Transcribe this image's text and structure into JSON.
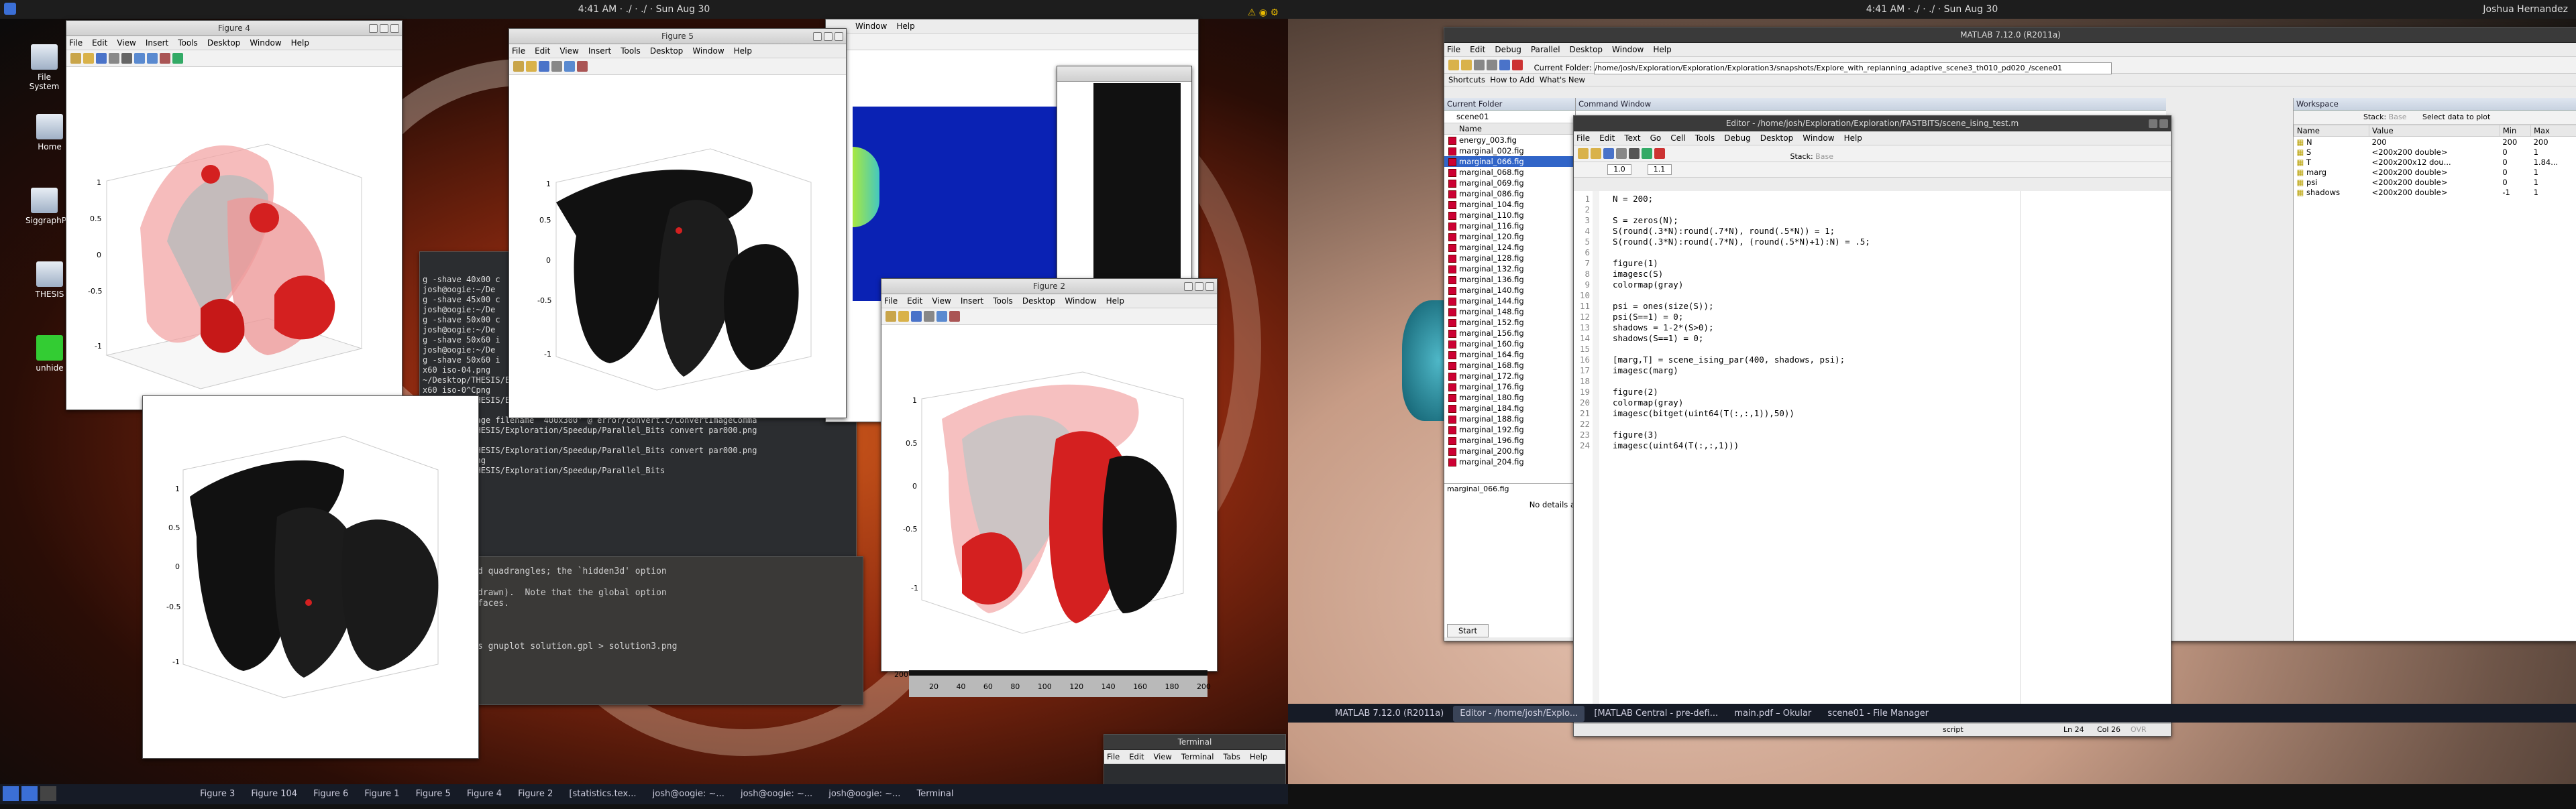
{
  "left_screen": {
    "topbar": {
      "clock": "4:41 AM · ./ · ./ · Sun Aug 30"
    },
    "desktop_icons": [
      "File System",
      "Home",
      "SiggraphP...",
      "THESIS",
      "unhide"
    ],
    "figure4": {
      "title": "Figure 4",
      "menu": [
        "File",
        "Edit",
        "View",
        "Insert",
        "Tools",
        "Desktop",
        "Window",
        "Help"
      ]
    },
    "figure5": {
      "title": "Figure 5",
      "menu": [
        "File",
        "Edit",
        "View",
        "Insert",
        "Tools",
        "Desktop",
        "Window",
        "Help"
      ]
    },
    "figure2": {
      "title": "Figure 2",
      "menu": [
        "File",
        "Edit",
        "View",
        "Insert",
        "Tools",
        "Desktop",
        "Window",
        "Help"
      ]
    },
    "figure_behind": {
      "menu": [
        "Window",
        "Help"
      ]
    },
    "terminal_lines": [
      "g -shave 40x00 c",
      "josh@oogie:~/De",
      "g -shave 45x00 c",
      "josh@oogie:~/De",
      "g -shave 50x00 c",
      "josh@oogie:~/De",
      "g -shave 50x60 i",
      "josh@oogie:~/De",
      "g -shave 50x60 i",
      "x60 iso-04.png",
      "~/Desktop/THESIS/Exploration/Speedup/Parallel_Bits convert iso-04.png",
      "x60 iso-0^Cpng",
      "~/Desktop/THESIS/Exploration/Speedup/Parallel_Bits convert par000.png",
      "0x300",
      "ssing an image filename `400x300' @ error/convert.c/ConvertImageComma",
      "~/Desktop/THESIS/Exploration/Speedup/Parallel_Bits convert par000.png",
      "0x300 out",
      "~/Desktop/THESIS/Exploration/Speedup/Parallel_Bits convert par000.png",
      "0x300 out.png",
      "~/Desktop/THESIS/Exploration/Speedup/Parallel_Bits"
    ],
    "doc_lines": [
      "d quadrangles; the `hidden3d' option",
      "",
      "drawn).  Note that the global option",
      "faces.",
      "",
      "",
      "",
      "s gnuplot solution.gpl > solution3.png"
    ],
    "small_terminal": {
      "title": "Terminal",
      "menu": [
        "File",
        "Edit",
        "View",
        "Terminal",
        "Tabs",
        "Help"
      ]
    },
    "heatmap_axis": {
      "ticks": [
        "20",
        "40",
        "60",
        "80",
        "100",
        "120",
        "140",
        "160",
        "180",
        "200"
      ],
      "y_bottom": "200"
    },
    "taskbar": [
      "Figure 3",
      "Figure 104",
      "Figure 6",
      "Figure 1",
      "Figure 5",
      "Figure 4",
      "Figure 2",
      "[statistics.tex...",
      "josh@oogie: ~...",
      "josh@oogie: ~...",
      "josh@oogie: ~...",
      "Terminal"
    ]
  },
  "right_screen": {
    "topbar": {
      "clock": "4:41 AM · ./ · ./ · Sun Aug 30",
      "user": "Joshua Hernandez"
    },
    "matlab": {
      "title": "MATLAB 7.12.0 (R2011a)",
      "menu": [
        "File",
        "Edit",
        "Debug",
        "Parallel",
        "Desktop",
        "Window",
        "Help"
      ],
      "current_folder_label": "Current Folder:",
      "current_folder_path": "/home/josh/Exploration/Exploration/Exploration3/snapshots/Explore_with_replanning_adaptive_scene3_th010_pd020_/scene01",
      "shortcuts": [
        "Shortcuts",
        "How to Add",
        "What's New"
      ],
      "current_folder_pane": "Current Folder",
      "folder_combo": "scene01",
      "name_header": "Name",
      "files": [
        "energy_003.fig",
        "marginal_002.fig",
        "marginal_066.fig",
        "marginal_068.fig",
        "marginal_069.fig",
        "marginal_086.fig",
        "marginal_104.fig",
        "marginal_110.fig",
        "marginal_116.fig",
        "marginal_120.fig",
        "marginal_124.fig",
        "marginal_128.fig",
        "marginal_132.fig",
        "marginal_136.fig",
        "marginal_140.fig",
        "marginal_144.fig",
        "marginal_148.fig",
        "marginal_152.fig",
        "marginal_156.fig",
        "marginal_160.fig",
        "marginal_164.fig",
        "marginal_168.fig",
        "marginal_172.fig",
        "marginal_176.fig",
        "marginal_180.fig",
        "marginal_184.fig",
        "marginal_188.fig",
        "marginal_192.fig",
        "marginal_196.fig",
        "marginal_200.fig",
        "marginal_204.fig"
      ],
      "selected_file": "marginal_066.fig",
      "folder_status": "marginal_066.fig",
      "no_details": "No details a",
      "start": "Start",
      "command_window": "Command Window",
      "workspace": {
        "title": "Workspace",
        "stack_label": "Stack:",
        "stack_value": "Base",
        "plot_select": "Select data to plot",
        "headers": [
          "Name",
          "Value",
          "Min",
          "Max"
        ],
        "rows": [
          [
            "N",
            "200",
            "200",
            "200"
          ],
          [
            "S",
            "<200x200 double>",
            "0",
            "1"
          ],
          [
            "T",
            "<200x200x12 dou...",
            "0",
            "1.84..."
          ],
          [
            "marg",
            "<200x200 double>",
            "0",
            "1"
          ],
          [
            "psi",
            "<200x200 double>",
            "0",
            "1"
          ],
          [
            "shadows",
            "<200x200 double>",
            "-1",
            "1"
          ]
        ]
      }
    },
    "editor": {
      "title": "Editor - /home/josh/Exploration/Exploration/FASTBITS/scene_ising_test.m",
      "menu": [
        "File",
        "Edit",
        "Text",
        "Go",
        "Cell",
        "Tools",
        "Debug",
        "Desktop",
        "Window",
        "Help"
      ],
      "stack_label": "Stack:",
      "stack_value": "Base",
      "cell_a": "1.0",
      "cell_b": "1.1",
      "lines": [
        "N = 200;",
        "",
        "S = zeros(N);",
        "S(round(.3*N):round(.7*N), round(.5*N)) = 1;",
        "S(round(.3*N):round(.7*N), (round(.5*N)+1):N) = .5;",
        "",
        "figure(1)",
        "imagesc(S)",
        "colormap(gray)",
        "",
        "psi = ones(size(S));",
        "psi(S==1) = 0;",
        "shadows = 1-2*(S>0);",
        "shadows(S==1) = 0;",
        "",
        "[marg,T] = scene_ising_par(400, shadows, psi);",
        "imagesc(marg)",
        "",
        "figure(2)",
        "colormap(gray)",
        "imagesc(bitget(uint64(T(:,:,1)),50))",
        "",
        "figure(3)",
        "imagesc(uint64(T(:,:,1)))"
      ],
      "status_script": "script",
      "status_ln": "Ln  24",
      "status_col": "Col  26",
      "status_mode": "OVR"
    },
    "taskbar": [
      "MATLAB 7.12.0 (R2011a)",
      "Editor - /home/josh/Explo...",
      "[MATLAB Central - pre-defi...",
      "main.pdf – Okular",
      "scene01 - File Manager"
    ]
  },
  "colors": {
    "red_surface": "#d42020",
    "black_mesh": "#111111",
    "matlab_selected": "#3165c8",
    "heatmap_blue": "#0a22b4"
  }
}
